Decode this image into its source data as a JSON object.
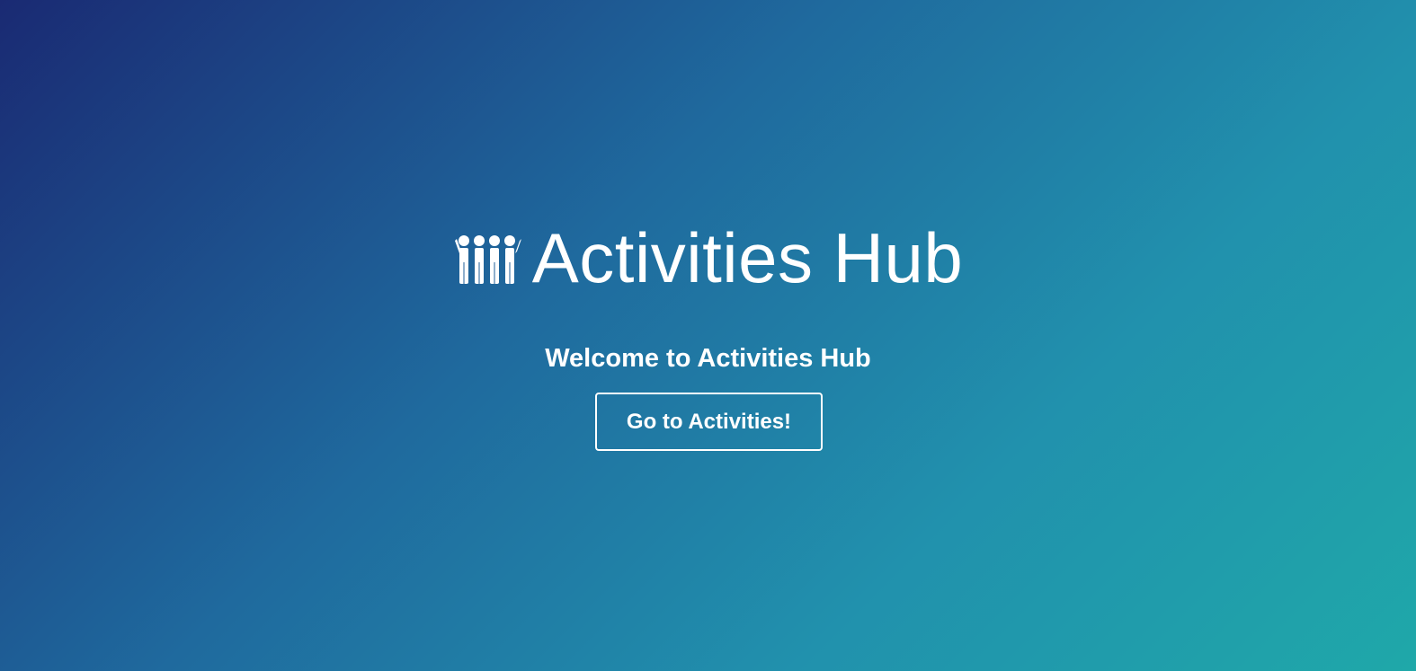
{
  "hero": {
    "logo_icon": "people-group-icon",
    "title": "Activities Hub",
    "subtitle": "Welcome to Activities Hub",
    "cta_label": "Go to Activities!"
  },
  "colors": {
    "gradient_start": "#1a2a73",
    "gradient_end": "#1fa8a9",
    "text": "#ffffff"
  }
}
